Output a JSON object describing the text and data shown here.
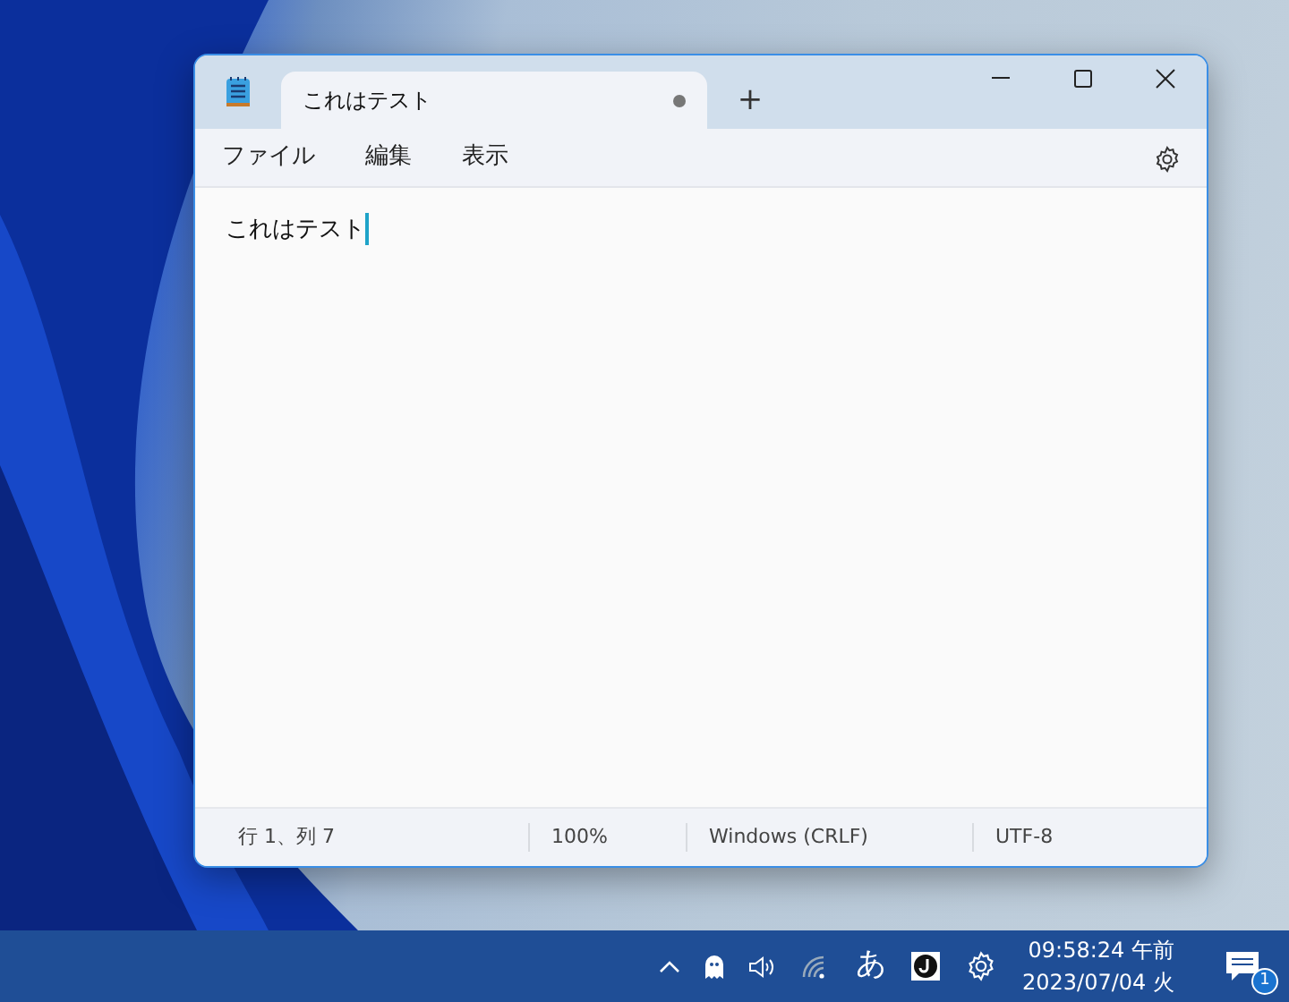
{
  "window": {
    "tabs": [
      {
        "title": "これはテスト",
        "unsaved": true,
        "selected": true
      }
    ],
    "new_tab": "+",
    "menu": [
      "ファイル",
      "編集",
      "表示"
    ],
    "document_text": "これはテスト",
    "status_bar": [
      "行 1、列 7",
      "100%",
      "Windows (CRLF)",
      "UTF-8"
    ]
  },
  "taskbar": {
    "ime": "あ",
    "time": "09:58:24 午前",
    "date": "2023/07/04 火",
    "notification_count": "1"
  }
}
